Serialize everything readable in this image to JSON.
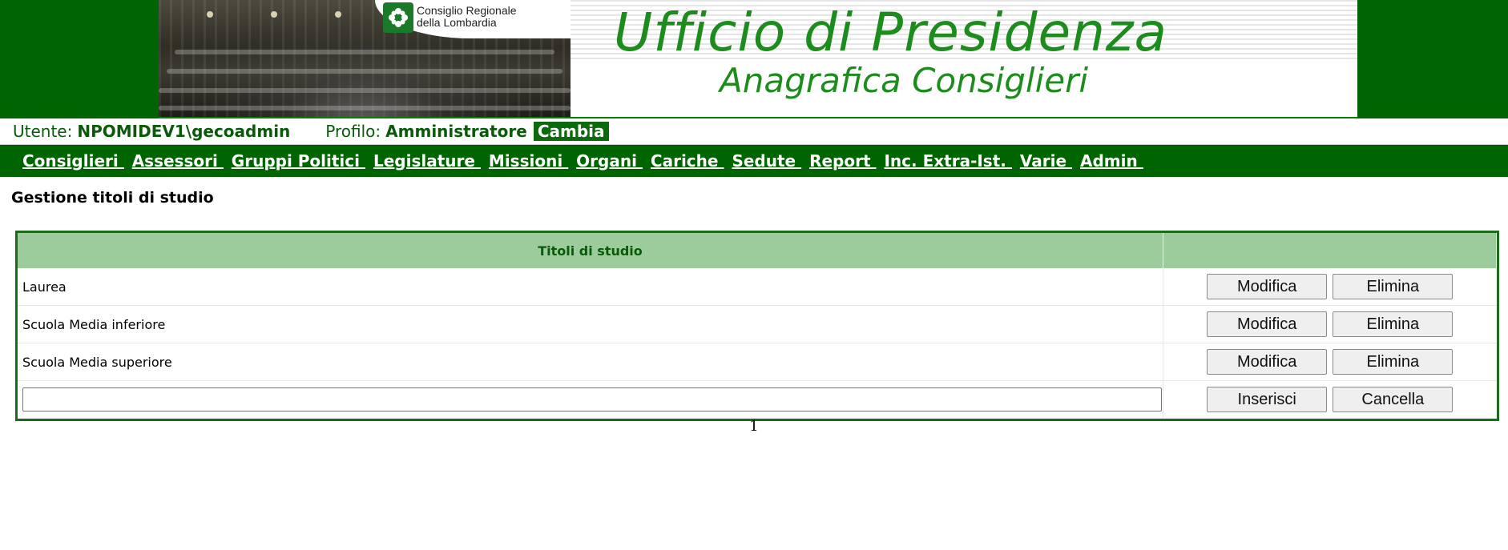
{
  "banner": {
    "logo_line1": "Consiglio Regionale",
    "logo_line2": "della Lombardia",
    "title": "Ufficio di Presidenza",
    "subtitle": "Anagrafica Consiglieri"
  },
  "userbar": {
    "user_label": "Utente:",
    "user_value": "NPOMIDEV1\\gecoadmin",
    "profile_label": "Profilo:",
    "profile_value": "Amministratore",
    "change_label": "Cambia"
  },
  "nav": [
    "Consiglieri",
    "Assessori",
    "Gruppi Politici",
    "Legislature",
    "Missioni",
    "Organi",
    "Cariche",
    "Sedute",
    "Report",
    "Inc. Extra-Ist.",
    "Varie",
    "Admin"
  ],
  "page": {
    "title": "Gestione titoli di studio"
  },
  "grid": {
    "column_header": "Titoli di studio",
    "rows": [
      {
        "name": "Laurea",
        "edit": "Modifica",
        "delete": "Elimina"
      },
      {
        "name": "Scuola Media inferiore",
        "edit": "Modifica",
        "delete": "Elimina"
      },
      {
        "name": "Scuola Media superiore",
        "edit": "Modifica",
        "delete": "Elimina"
      }
    ],
    "new_row": {
      "value": "",
      "insert": "Inserisci",
      "cancel": "Cancella"
    }
  },
  "pager": {
    "current_page": "1"
  },
  "colors": {
    "brand_green": "#006400",
    "header_green_light": "#9ccc9c",
    "title_green": "#1c8c1c"
  }
}
